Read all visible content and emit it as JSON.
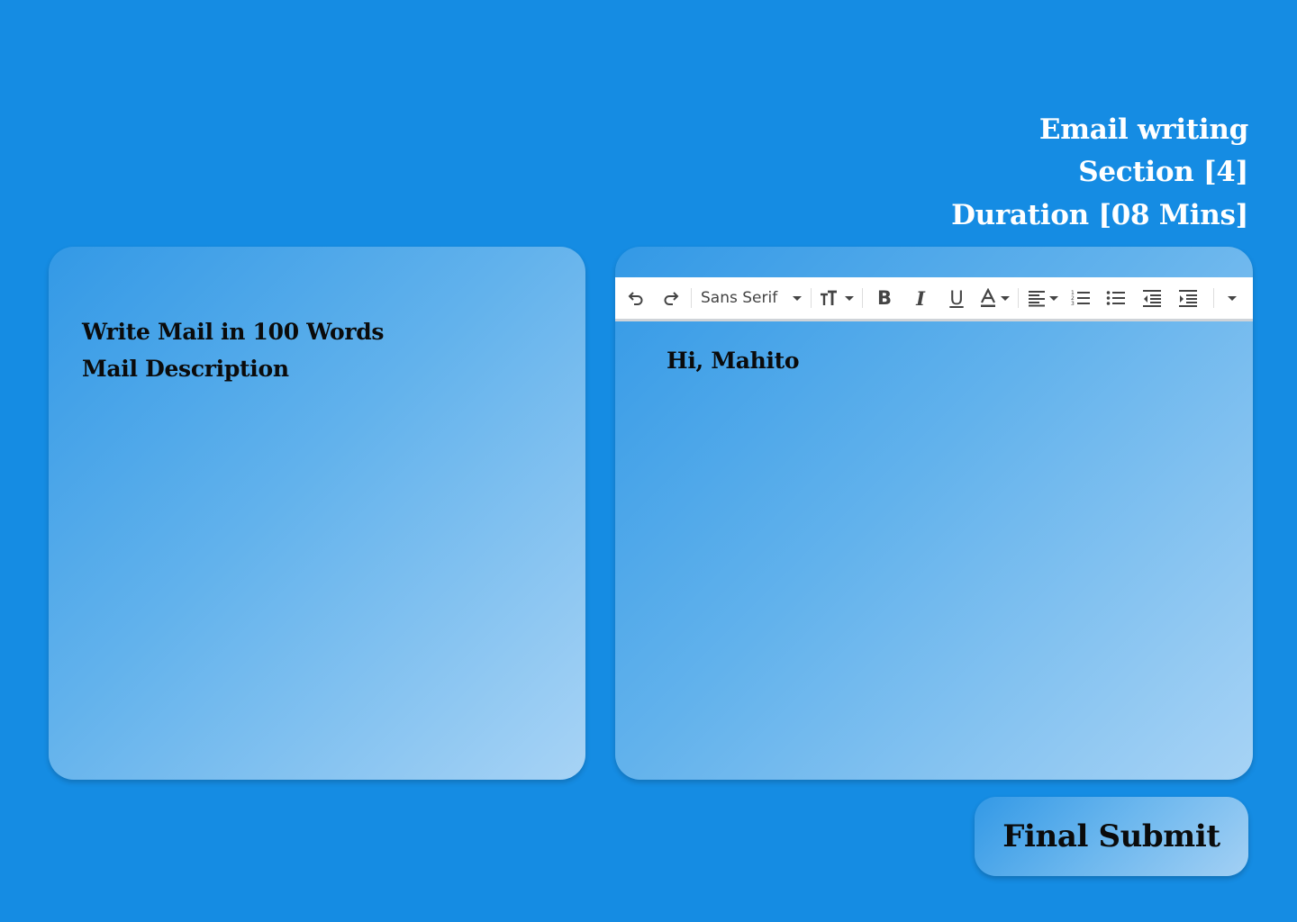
{
  "header": {
    "title": "Email writing",
    "section": "Section [4]",
    "duration": "Duration [08 Mins]"
  },
  "prompt_panel": {
    "instruction": "Write Mail in 100 Words",
    "description_label": "Mail Description"
  },
  "editor": {
    "toolbar": {
      "font_family": "Sans Serif",
      "icons": [
        "undo-icon",
        "redo-icon",
        "font-size-icon",
        "bold-icon",
        "italic-icon",
        "underline-icon",
        "text-color-icon",
        "align-icon",
        "numbered-list-icon",
        "bulleted-list-icon",
        "indent-less-icon",
        "indent-more-icon",
        "more-options-icon"
      ]
    },
    "content": "Hi, Mahito"
  },
  "actions": {
    "submit_label": "Final Submit"
  },
  "colors": {
    "background": "#158ce3",
    "text_dark": "#0b0b0b",
    "header_text": "#ffffff"
  }
}
